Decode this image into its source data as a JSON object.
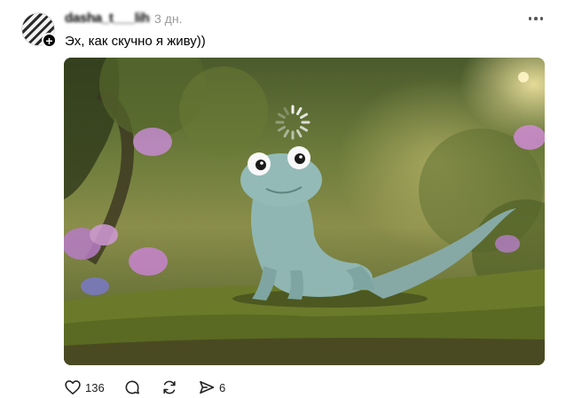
{
  "post": {
    "username": "dasha_t___lih",
    "time": "3 дн.",
    "caption": "Эх, как скучно я живу))",
    "actions": {
      "likes": "136",
      "reposts": "6"
    }
  },
  "icons": {
    "avatar": "avatar",
    "follow": "plus-icon",
    "more": "more-dots-icon",
    "like": "heart-icon",
    "comment": "comment-icon",
    "repost": "repost-icon",
    "share": "send-icon",
    "loading": "loading-spinner-icon"
  },
  "colors": {
    "time": "#999999",
    "text": "#000000"
  }
}
